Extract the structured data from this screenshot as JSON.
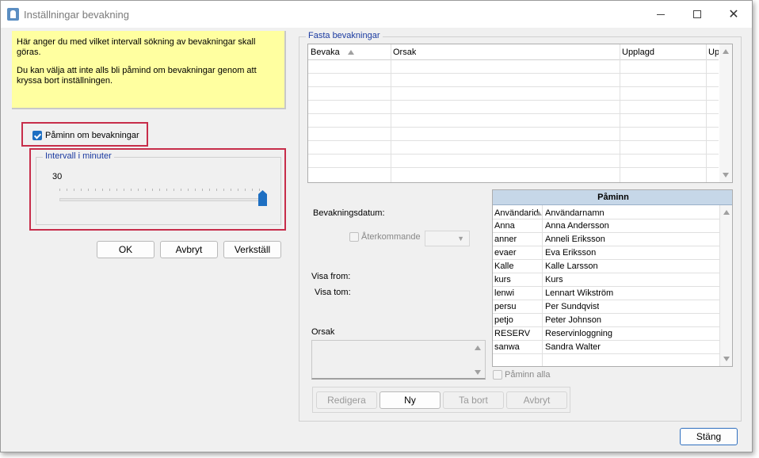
{
  "window": {
    "title": "Inställningar bevakning"
  },
  "info": {
    "line1": "Här anger du med vilket intervall sökning av bevakningar skall göras.",
    "line2": "Du kan välja att inte alls bli påmind om bevakningar genom att kryssa bort inställningen."
  },
  "reminder": {
    "label": "Påminn om bevakningar",
    "checked": true
  },
  "interval": {
    "legend": "Intervall i minuter",
    "value": "30"
  },
  "left_buttons": {
    "ok": "OK",
    "cancel": "Avbryt",
    "apply": "Verkställ"
  },
  "fixed": {
    "legend": "Fasta bevakningar",
    "columns": [
      "Bevaka",
      "Orsak",
      "Upplagd",
      "Up"
    ]
  },
  "form": {
    "date_label": "Bevakningsdatum:",
    "recurring_label": "Återkommande",
    "show_from_label": "Visa from:",
    "show_to_label": "Visa tom:",
    "reason_label": "Orsak"
  },
  "remind": {
    "header": "Påminn",
    "columns": [
      "Användarid",
      "Användarnamn"
    ],
    "rows": [
      [
        "Anna",
        "Anna Andersson"
      ],
      [
        "anner",
        "Anneli Eriksson"
      ],
      [
        "evaer",
        "Eva Eriksson"
      ],
      [
        "Kalle",
        "Kalle Larsson"
      ],
      [
        "kurs",
        "Kurs"
      ],
      [
        "lenwi",
        "Lennart Wikström"
      ],
      [
        "persu",
        "Per Sundqvist"
      ],
      [
        "petjo",
        "Peter Johnson"
      ],
      [
        "RESERV",
        "Reservinloggning"
      ],
      [
        "sanwa",
        "Sandra Walter"
      ]
    ],
    "remind_all_label": "Påminn alla"
  },
  "action_buttons": {
    "edit": "Redigera",
    "new": "Ny",
    "delete": "Ta bort",
    "cancel": "Avbryt"
  },
  "close_button": "Stäng"
}
